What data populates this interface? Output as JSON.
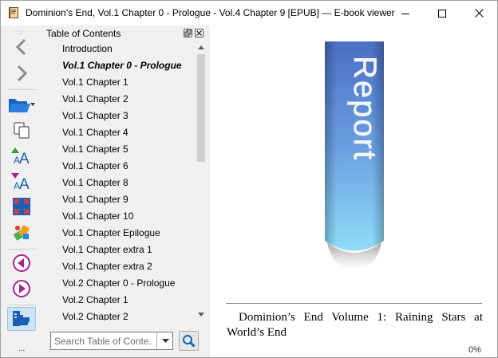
{
  "window": {
    "title": "Dominion’s End, Vol.1 Chapter 0 - Prologue - Vol.4 Chapter 9 [EPUB] — E-book viewer",
    "controls": [
      "minimize-icon",
      "maximize-icon",
      "close-icon"
    ]
  },
  "toolbar": {
    "grip": "::::",
    "buttons": [
      {
        "name": "back",
        "icon": "chevron-left-icon"
      },
      {
        "name": "forward",
        "icon": "chevron-right-icon"
      },
      {
        "name": "open-ebook",
        "icon": "folder-open-icon"
      },
      {
        "name": "copy",
        "icon": "copy-icon"
      },
      {
        "name": "font-size-larger",
        "icon": "font-larger-icon"
      },
      {
        "name": "font-size-smaller",
        "icon": "font-smaller-icon"
      },
      {
        "name": "fullscreen",
        "icon": "fullscreen-icon"
      },
      {
        "name": "preferences",
        "icon": "preferences-icon"
      },
      {
        "name": "previous-page",
        "icon": "arrow-left-circle-icon"
      },
      {
        "name": "next-page",
        "icon": "arrow-right-circle-icon"
      },
      {
        "name": "toc-toggle",
        "icon": "hand-pointer-icon",
        "active": true
      }
    ],
    "more": "..."
  },
  "toc": {
    "title": "Table of Contents",
    "items": [
      {
        "label": "Introduction",
        "current": false
      },
      {
        "label": "Vol.1 Chapter 0 - Prologue",
        "current": true
      },
      {
        "label": "Vol.1 Chapter 1",
        "current": false
      },
      {
        "label": "Vol.1 Chapter 2",
        "current": false
      },
      {
        "label": "Vol.1 Chapter 3",
        "current": false
      },
      {
        "label": "Vol.1 Chapter 4",
        "current": false
      },
      {
        "label": "Vol.1 Chapter 5",
        "current": false
      },
      {
        "label": "Vol.1 Chapter 6",
        "current": false
      },
      {
        "label": "Vol.1 Chapter 8",
        "current": false
      },
      {
        "label": "Vol.1 Chapter 9",
        "current": false
      },
      {
        "label": "Vol.1 Chapter 10",
        "current": false
      },
      {
        "label": "Vol.1 Chapter Epilogue",
        "current": false
      },
      {
        "label": "Vol.1 Chapter extra 1",
        "current": false
      },
      {
        "label": "Vol.1 Chapter extra 2",
        "current": false
      },
      {
        "label": "Vol.2 Chapter 0 - Prologue",
        "current": false
      },
      {
        "label": "Vol.2 Chapter 1",
        "current": false
      },
      {
        "label": "Vol.2 Chapter 2",
        "current": false
      }
    ],
    "search_placeholder": "Search Table of Conte..."
  },
  "reader": {
    "cover_text": "Report",
    "book_line": "Dominion’s End Volume 1: Raining Stars at World’s End",
    "progress": "0%"
  },
  "colors": {
    "accent": "#1a6fd1",
    "cover_top": "#4a6fc4",
    "cover_bottom": "#8fdcf8",
    "toolbar_active": "#cfe3f7"
  }
}
